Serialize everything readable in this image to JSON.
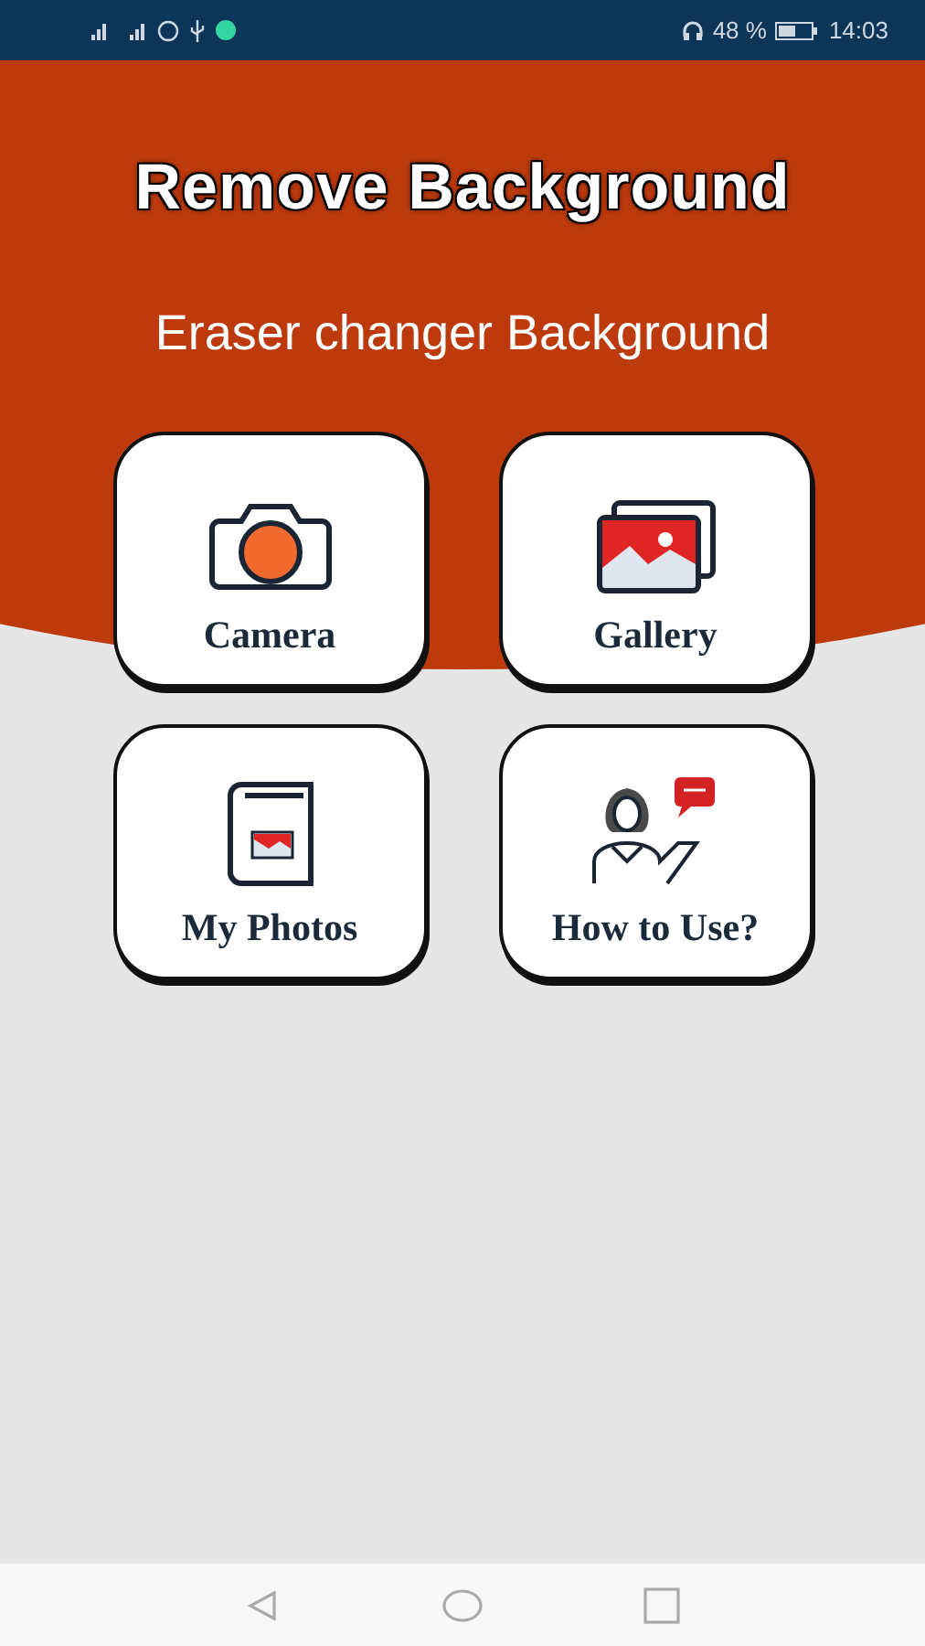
{
  "status_bar": {
    "battery": "48 %",
    "time": "14:03"
  },
  "header": {
    "title": "Remove Background",
    "subtitle": "Eraser changer Background"
  },
  "tiles": [
    {
      "kind": "camera",
      "label": "Camera"
    },
    {
      "kind": "gallery",
      "label": "Gallery"
    },
    {
      "kind": "album",
      "label": "My Photos"
    },
    {
      "kind": "help",
      "label": "How to Use?"
    }
  ]
}
